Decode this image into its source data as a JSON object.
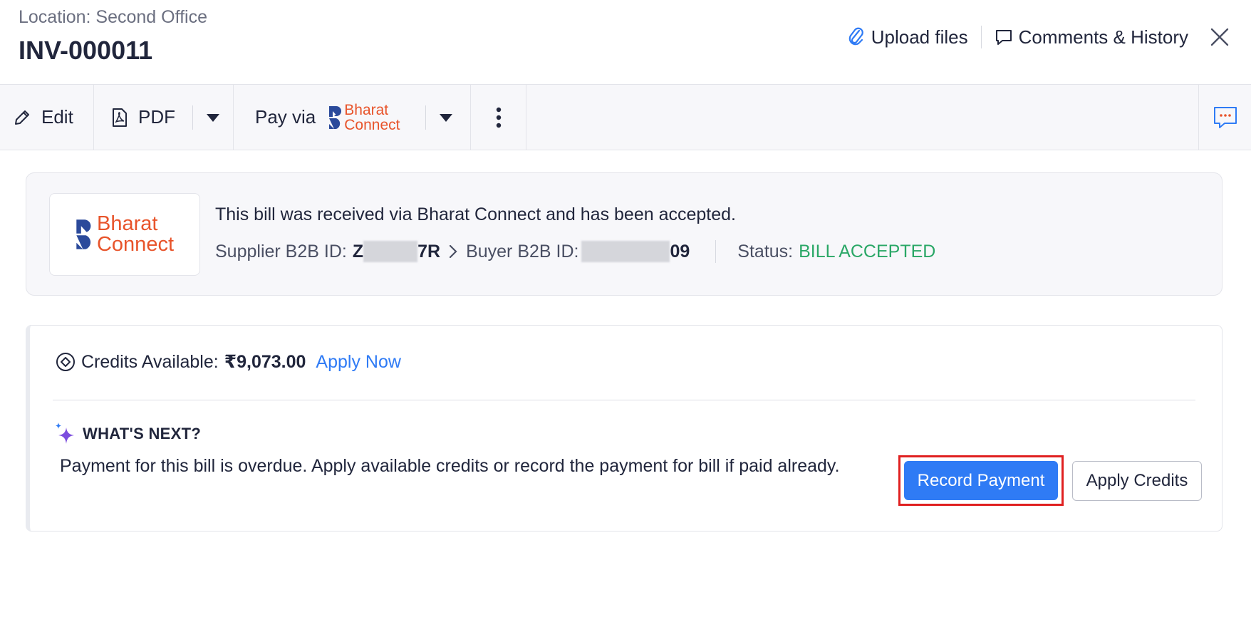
{
  "header": {
    "location": "Location: Second Office",
    "title": "INV-000011",
    "upload_label": "Upload files",
    "comments_label": "Comments & History"
  },
  "toolbar": {
    "edit_label": "Edit",
    "pdf_label": "PDF",
    "pay_label": "Pay via",
    "pay_logo_line1": "Bharat",
    "pay_logo_line2": "Connect"
  },
  "banner": {
    "logo_line1": "Bharat",
    "logo_line2": "Connect",
    "message": "This bill was received via Bharat Connect and has been accepted.",
    "supplier_label": "Supplier B2B ID:",
    "supplier_prefix": "Z",
    "supplier_suffix": "7R",
    "buyer_label": "Buyer B2B ID:",
    "buyer_suffix": "09",
    "status_label": "Status:",
    "status_value": "BILL ACCEPTED"
  },
  "credits": {
    "label": "Credits Available:",
    "amount": "₹9,073.00",
    "apply_now": "Apply Now"
  },
  "whats_next": {
    "title": "WHAT'S NEXT?",
    "text": "Payment for this bill is overdue. Apply available credits or record the payment for bill if paid already.",
    "record_payment": "Record Payment",
    "apply_credits": "Apply Credits"
  },
  "colors": {
    "accent_blue": "#2f7bf5",
    "brand_orange": "#e8542b",
    "brand_blue": "#2b4a9b",
    "status_green": "#2aa766",
    "highlight_red": "#e02020"
  }
}
